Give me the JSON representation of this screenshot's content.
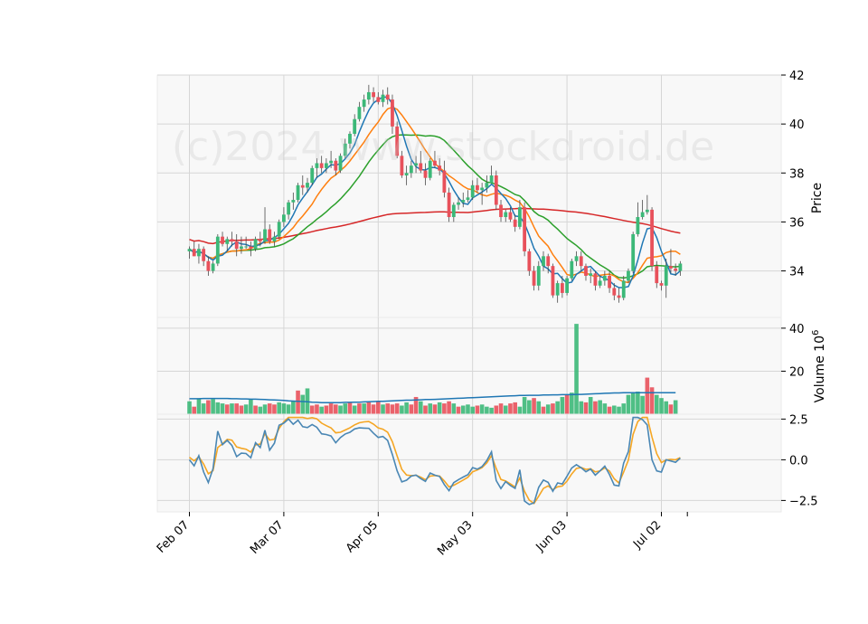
{
  "watermark": "(c)2024 www.stockdroid.de",
  "chart_data": {
    "type": "candlestick",
    "x_tick_labels": [
      "Feb 07",
      "Mar 07",
      "Apr 05",
      "May 03",
      "Jun 03",
      "Jul 02"
    ],
    "x_tick_index": [
      0,
      20,
      40,
      60,
      80,
      100
    ],
    "price": {
      "ylabel": "Price",
      "ylim": [
        32.1,
        42.0
      ],
      "yticks": [
        34,
        36,
        38,
        40,
        42
      ],
      "ohlc": [
        [
          34.8,
          35.0,
          34.5,
          34.9
        ],
        [
          34.9,
          35.2,
          34.6,
          34.6
        ],
        [
          34.6,
          35.1,
          34.3,
          34.9
        ],
        [
          34.9,
          35.0,
          34.2,
          34.4
        ],
        [
          34.4,
          34.6,
          33.8,
          34.0
        ],
        [
          34.0,
          34.4,
          33.9,
          34.3
        ],
        [
          34.3,
          35.5,
          34.2,
          35.4
        ],
        [
          35.4,
          35.6,
          35.0,
          35.1
        ],
        [
          35.1,
          35.4,
          34.8,
          35.3
        ],
        [
          35.3,
          35.6,
          35.0,
          35.2
        ],
        [
          35.2,
          35.5,
          34.6,
          34.9
        ],
        [
          34.9,
          35.4,
          34.7,
          35.0
        ],
        [
          35.0,
          35.4,
          34.9,
          35.0
        ],
        [
          35.0,
          35.2,
          34.6,
          34.9
        ],
        [
          34.9,
          35.4,
          34.8,
          35.3
        ],
        [
          35.3,
          35.6,
          35.0,
          35.2
        ],
        [
          35.2,
          36.6,
          35.1,
          35.7
        ],
        [
          35.7,
          35.9,
          35.1,
          35.2
        ],
        [
          35.2,
          35.6,
          35.0,
          35.4
        ],
        [
          35.4,
          36.1,
          35.3,
          36.0
        ],
        [
          36.0,
          36.6,
          35.8,
          36.3
        ],
        [
          36.3,
          36.9,
          36.1,
          36.8
        ],
        [
          36.8,
          37.2,
          36.5,
          36.9
        ],
        [
          36.9,
          37.6,
          36.8,
          37.5
        ],
        [
          37.5,
          37.9,
          37.1,
          37.4
        ],
        [
          37.4,
          37.8,
          37.2,
          37.6
        ],
        [
          37.6,
          38.3,
          37.5,
          38.2
        ],
        [
          38.2,
          38.6,
          37.8,
          38.4
        ],
        [
          38.4,
          38.7,
          38.0,
          38.2
        ],
        [
          38.2,
          38.6,
          38.0,
          38.4
        ],
        [
          38.4,
          38.9,
          38.2,
          38.5
        ],
        [
          38.5,
          38.6,
          37.9,
          38.1
        ],
        [
          38.1,
          38.8,
          38.0,
          38.7
        ],
        [
          38.7,
          39.4,
          38.6,
          39.2
        ],
        [
          39.2,
          39.7,
          39.0,
          39.6
        ],
        [
          39.6,
          40.4,
          39.5,
          40.2
        ],
        [
          40.2,
          40.9,
          40.1,
          40.7
        ],
        [
          40.7,
          41.2,
          40.5,
          41.0
        ],
        [
          41.0,
          41.6,
          40.8,
          41.3
        ],
        [
          41.3,
          41.5,
          40.9,
          41.1
        ],
        [
          41.1,
          41.3,
          40.8,
          40.9
        ],
        [
          40.9,
          41.4,
          40.7,
          41.2
        ],
        [
          41.2,
          41.5,
          40.8,
          41.0
        ],
        [
          41.0,
          41.2,
          39.6,
          39.9
        ],
        [
          39.9,
          40.1,
          38.6,
          38.7
        ],
        [
          38.7,
          38.9,
          37.8,
          37.9
        ],
        [
          37.9,
          38.3,
          37.5,
          38.0
        ],
        [
          38.0,
          38.5,
          37.8,
          38.3
        ],
        [
          38.3,
          38.7,
          38.0,
          38.4
        ],
        [
          38.4,
          38.9,
          38.0,
          38.1
        ],
        [
          38.1,
          38.4,
          37.5,
          37.8
        ],
        [
          37.8,
          38.6,
          37.7,
          38.5
        ],
        [
          38.5,
          38.9,
          38.2,
          38.3
        ],
        [
          38.3,
          38.6,
          37.9,
          38.1
        ],
        [
          38.1,
          38.5,
          37.0,
          37.2
        ],
        [
          37.2,
          37.4,
          36.0,
          36.2
        ],
        [
          36.2,
          36.8,
          36.0,
          36.7
        ],
        [
          36.7,
          37.0,
          36.5,
          36.8
        ],
        [
          36.8,
          37.2,
          36.6,
          36.9
        ],
        [
          36.9,
          37.3,
          36.8,
          37.0
        ],
        [
          37.0,
          37.7,
          36.9,
          37.5
        ],
        [
          37.5,
          37.8,
          37.2,
          37.3
        ],
        [
          37.3,
          37.6,
          36.7,
          37.4
        ],
        [
          37.4,
          37.9,
          37.2,
          37.6
        ],
        [
          37.6,
          38.3,
          37.6,
          37.9
        ],
        [
          37.9,
          38.1,
          36.5,
          36.7
        ],
        [
          36.7,
          36.9,
          36.0,
          36.2
        ],
        [
          36.2,
          36.5,
          36.0,
          36.4
        ],
        [
          36.4,
          36.6,
          36.0,
          36.1
        ],
        [
          36.1,
          36.3,
          35.6,
          35.8
        ],
        [
          35.8,
          36.9,
          35.7,
          36.6
        ],
        [
          36.6,
          36.8,
          34.6,
          34.8
        ],
        [
          34.8,
          34.9,
          33.8,
          34.0
        ],
        [
          34.0,
          34.2,
          33.2,
          33.4
        ],
        [
          33.4,
          34.4,
          33.2,
          34.2
        ],
        [
          34.2,
          34.8,
          34.0,
          34.6
        ],
        [
          34.6,
          34.7,
          33.9,
          34.2
        ],
        [
          34.2,
          34.3,
          32.9,
          33.0
        ],
        [
          33.0,
          33.6,
          32.7,
          33.5
        ],
        [
          33.5,
          33.8,
          32.9,
          33.1
        ],
        [
          33.1,
          33.8,
          33.0,
          33.7
        ],
        [
          33.7,
          34.5,
          33.6,
          34.4
        ],
        [
          34.4,
          34.8,
          34.2,
          34.6
        ],
        [
          34.6,
          34.8,
          34.0,
          34.2
        ],
        [
          34.2,
          34.3,
          33.6,
          33.8
        ],
        [
          33.8,
          34.1,
          33.5,
          33.9
        ],
        [
          33.9,
          34.0,
          33.2,
          33.4
        ],
        [
          33.4,
          33.8,
          33.3,
          33.6
        ],
        [
          33.6,
          34.0,
          33.4,
          33.8
        ],
        [
          33.8,
          34.0,
          33.1,
          33.3
        ],
        [
          33.3,
          33.5,
          32.8,
          33.0
        ],
        [
          33.0,
          33.3,
          32.7,
          32.9
        ],
        [
          32.9,
          33.8,
          32.8,
          33.6
        ],
        [
          33.6,
          34.1,
          33.5,
          34.0
        ],
        [
          34.0,
          35.6,
          33.9,
          35.5
        ],
        [
          35.5,
          36.8,
          35.4,
          36.2
        ],
        [
          36.2,
          36.9,
          36.1,
          36.4
        ],
        [
          36.4,
          37.1,
          36.3,
          36.5
        ],
        [
          36.5,
          36.6,
          34.0,
          34.2
        ],
        [
          34.2,
          34.4,
          33.3,
          33.5
        ],
        [
          33.5,
          33.6,
          33.2,
          33.4
        ],
        [
          33.4,
          34.5,
          32.9,
          34.2
        ],
        [
          34.2,
          34.9,
          33.9,
          34.1
        ],
        [
          34.1,
          34.3,
          33.8,
          34.0
        ],
        [
          34.0,
          34.4,
          33.8,
          34.3
        ]
      ]
    },
    "volume": {
      "ylabel": "Volume $10^6$",
      "ylim": [
        0,
        45
      ],
      "yticks": [
        20,
        40
      ],
      "values": [
        [
          6.0,
          1
        ],
        [
          3.5,
          0
        ],
        [
          7.0,
          1
        ],
        [
          5.0,
          1
        ],
        [
          6.5,
          0
        ],
        [
          7.0,
          1
        ],
        [
          5.5,
          1
        ],
        [
          5.0,
          1
        ],
        [
          4.5,
          0
        ],
        [
          5.0,
          1
        ],
        [
          5.0,
          0
        ],
        [
          4.0,
          0
        ],
        [
          4.5,
          1
        ],
        [
          7.0,
          1
        ],
        [
          4.0,
          0
        ],
        [
          3.5,
          1
        ],
        [
          4.5,
          1
        ],
        [
          5.0,
          0
        ],
        [
          4.5,
          0
        ],
        [
          5.5,
          1
        ],
        [
          5.0,
          1
        ],
        [
          4.5,
          1
        ],
        [
          6.0,
          1
        ],
        [
          11.0,
          0
        ],
        [
          9.0,
          1
        ],
        [
          12.0,
          1
        ],
        [
          4.0,
          0
        ],
        [
          4.5,
          0
        ],
        [
          3.5,
          1
        ],
        [
          4.0,
          0
        ],
        [
          5.0,
          0
        ],
        [
          4.5,
          0
        ],
        [
          4.0,
          1
        ],
        [
          5.0,
          1
        ],
        [
          5.5,
          0
        ],
        [
          4.0,
          1
        ],
        [
          5.0,
          0
        ],
        [
          5.0,
          1
        ],
        [
          5.5,
          0
        ],
        [
          4.5,
          0
        ],
        [
          6.0,
          0
        ],
        [
          4.5,
          1
        ],
        [
          5.0,
          0
        ],
        [
          4.5,
          0
        ],
        [
          5.0,
          0
        ],
        [
          4.0,
          1
        ],
        [
          5.5,
          1
        ],
        [
          4.5,
          0
        ],
        [
          8.0,
          0
        ],
        [
          6.0,
          1
        ],
        [
          4.0,
          0
        ],
        [
          5.0,
          1
        ],
        [
          4.5,
          0
        ],
        [
          5.5,
          1
        ],
        [
          5.0,
          0
        ],
        [
          6.0,
          0
        ],
        [
          5.0,
          1
        ],
        [
          3.5,
          0
        ],
        [
          4.0,
          1
        ],
        [
          4.5,
          1
        ],
        [
          3.5,
          1
        ],
        [
          4.0,
          0
        ],
        [
          4.5,
          1
        ],
        [
          3.5,
          1
        ],
        [
          3.0,
          1
        ],
        [
          4.0,
          0
        ],
        [
          5.0,
          0
        ],
        [
          4.0,
          1
        ],
        [
          5.0,
          0
        ],
        [
          5.5,
          0
        ],
        [
          3.5,
          1
        ],
        [
          8.0,
          1
        ],
        [
          6.5,
          1
        ],
        [
          7.5,
          0
        ],
        [
          6.0,
          1
        ],
        [
          3.5,
          0
        ],
        [
          4.5,
          1
        ],
        [
          5.0,
          0
        ],
        [
          6.0,
          1
        ],
        [
          8.0,
          1
        ],
        [
          9.0,
          0
        ],
        [
          10.0,
          1
        ],
        [
          42.0,
          1
        ],
        [
          6.0,
          1
        ],
        [
          5.5,
          0
        ],
        [
          8.0,
          1
        ],
        [
          6.0,
          0
        ],
        [
          6.5,
          1
        ],
        [
          5.0,
          1
        ],
        [
          3.5,
          0
        ],
        [
          4.0,
          1
        ],
        [
          3.5,
          1
        ],
        [
          5.0,
          1
        ],
        [
          9.0,
          1
        ],
        [
          10.0,
          1
        ],
        [
          10.5,
          1
        ],
        [
          8.5,
          1
        ],
        [
          17.0,
          0
        ],
        [
          12.5,
          0
        ],
        [
          9.0,
          1
        ],
        [
          7.5,
          1
        ],
        [
          6.0,
          1
        ],
        [
          4.5,
          0
        ],
        [
          6.5,
          1
        ]
      ],
      "ma_line": [
        7.2,
        7.2,
        7.2,
        7.3,
        7.3,
        7.3,
        7.3,
        7.3,
        7.3,
        7.2,
        7.2,
        7.1,
        7.1,
        7.0,
        7.0,
        6.9,
        6.8,
        6.7,
        6.6,
        6.5,
        6.4,
        6.2,
        6.1,
        6.0,
        5.9,
        5.8,
        5.6,
        5.5,
        5.4,
        5.4,
        5.4,
        5.4,
        5.4,
        5.5,
        5.5,
        5.6,
        5.6,
        5.7,
        5.8,
        5.9,
        6.0,
        6.0,
        6.1,
        6.2,
        6.3,
        6.4,
        6.5,
        6.5,
        6.6,
        6.7,
        6.8,
        6.8,
        6.9,
        7.0,
        7.1,
        7.2,
        7.3,
        7.4,
        7.5,
        7.6,
        7.7,
        7.8,
        7.9,
        8.0,
        8.1,
        8.2,
        8.3,
        8.4,
        8.5,
        8.6,
        8.7,
        8.7,
        8.8,
        8.8,
        8.8,
        8.9,
        8.9,
        9.0,
        9.0,
        9.1,
        9.1,
        9.1,
        9.2,
        9.2,
        9.3,
        9.4,
        9.5,
        9.6,
        9.7,
        9.8,
        9.9,
        9.9,
        10.0,
        10.0,
        10.0,
        10.0,
        10.0,
        10.0,
        10.0,
        10.0,
        10.0,
        10.0,
        10.0,
        10.0
      ]
    },
    "oscillator": {
      "ylim": [
        -3.2,
        2.8
      ],
      "yticks": [
        -2.5,
        0.0,
        2.5
      ],
      "ytick_labels": [
        "−2.5",
        "0.0",
        "2.5"
      ]
    },
    "overlay_colors": {
      "ma_blue": "#1f77b4",
      "ma_orange": "#ff7f0e",
      "ma_green": "#2ca02c",
      "ma_red": "#d62728",
      "osc_blue": "#4a87b4",
      "osc_orange": "#f5a623",
      "up": "#3cb878",
      "down": "#e8515b"
    }
  }
}
